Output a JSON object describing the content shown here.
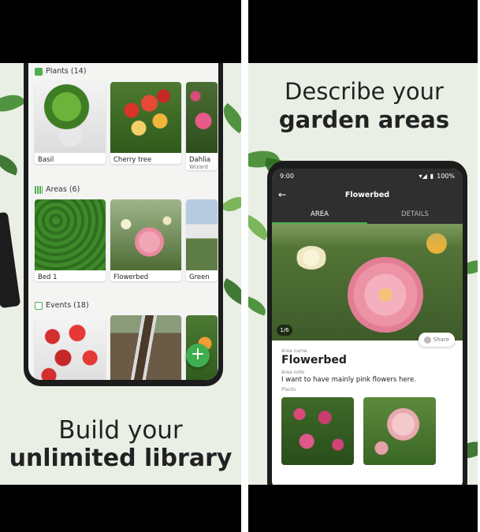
{
  "left_panel": {
    "sections": [
      {
        "icon": "plant-icon",
        "title": "Plants (14)",
        "items": [
          {
            "label": "Basil",
            "sublabel": ""
          },
          {
            "label": "Cherry tree",
            "sublabel": ""
          },
          {
            "label": "Dahlia",
            "sublabel": "Wizard"
          }
        ]
      },
      {
        "icon": "grid-icon",
        "title": "Areas (6)",
        "items": [
          {
            "label": "Bed 1",
            "sublabel": ""
          },
          {
            "label": "Flowerbed",
            "sublabel": ""
          },
          {
            "label": "Green",
            "sublabel": ""
          }
        ]
      },
      {
        "icon": "calendar-icon",
        "title": "Events (18)",
        "items": [
          {
            "label": "",
            "sublabel": ""
          },
          {
            "label": "",
            "sublabel": ""
          },
          {
            "label": "",
            "sublabel": ""
          }
        ]
      }
    ],
    "fab_label": "+",
    "headline_line1": "Build your",
    "headline_line2": "unlimited library"
  },
  "right_panel": {
    "headline_line1": "Describe your",
    "headline_line2": "garden areas",
    "status": {
      "time": "9:00",
      "battery": "100%"
    },
    "appbar_title": "Flowerbed",
    "tabs": [
      {
        "label": "AREA",
        "active": true
      },
      {
        "label": "DETAILS",
        "active": false
      }
    ],
    "photo_counter": "1/6",
    "share_label": "Share",
    "area_name_label": "Area name",
    "area_name": "Flowerbed",
    "area_note_label": "Area note",
    "area_note": "I want to have mainly pink flowers here.",
    "plants_label": "Plants"
  },
  "colors": {
    "accent": "#4caf50",
    "dark_bar": "#2e2f2e",
    "background": "#e9efe5"
  }
}
